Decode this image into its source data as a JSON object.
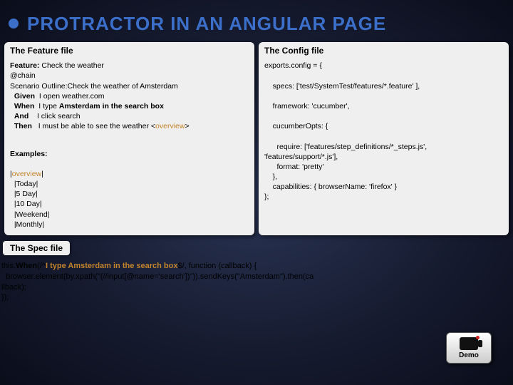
{
  "title": "PROTRACTOR IN AN ANGULAR PAGE",
  "feature": {
    "heading": "The Feature file",
    "featureLabel": "Feature:",
    "featureText": " Check the weather",
    "tag": "@chain",
    "scenarioLine": "Scenario Outline:Check the weather of Amsterdam",
    "givenKw": "Given",
    "givenText": "I open weather.com",
    "whenKw": "When",
    "whenText1": "I type ",
    "whenBold": "Amsterdam in the search box",
    "andKw": "And",
    "andText": "I click search",
    "thenKw": "Then",
    "thenText1": "I must be able to see the weather <",
    "thenOv": "overview",
    "thenText2": ">",
    "examplesHeading": "Examples:",
    "exRow0a": "|",
    "exRow0b": "overview",
    "exRow0c": "|",
    "exRow1": "  |Today|",
    "exRow2": "  |5 Day|",
    "exRow3": "  |10 Day|",
    "exRow4": "  |Weekend|",
    "exRow5": "  |Monthly|"
  },
  "config": {
    "heading": "The Config file",
    "line1": "exports.config = {",
    "line2": "    specs: ['test/SystemTest/features/*.feature' ],",
    "line3": "    framework: 'cucumber',",
    "line4": "    cucumberOpts: {",
    "line5": "      require: ['features/step_definitions/*_steps.js',",
    "line6": "'features/support/*.js'],",
    "line7": "      format: 'pretty'",
    "line8": "    },",
    "line9": "    capabilities: { browserName: 'firefox' }",
    "line10": "};"
  },
  "spec": {
    "heading": "The Spec file",
    "pre": "this.",
    "when": "When",
    "after1": "(/^",
    "itype": "I type Amsterdam in the search box",
    "after2": "$/, function (callback) {",
    "body": "  browser.element(by.xpath(\"(//input[@name='search'])\")).sendKeys(\"Amsterdam\").then(ca",
    "body2": "llback);",
    "close": "});"
  },
  "demo": {
    "label": "Demo"
  }
}
